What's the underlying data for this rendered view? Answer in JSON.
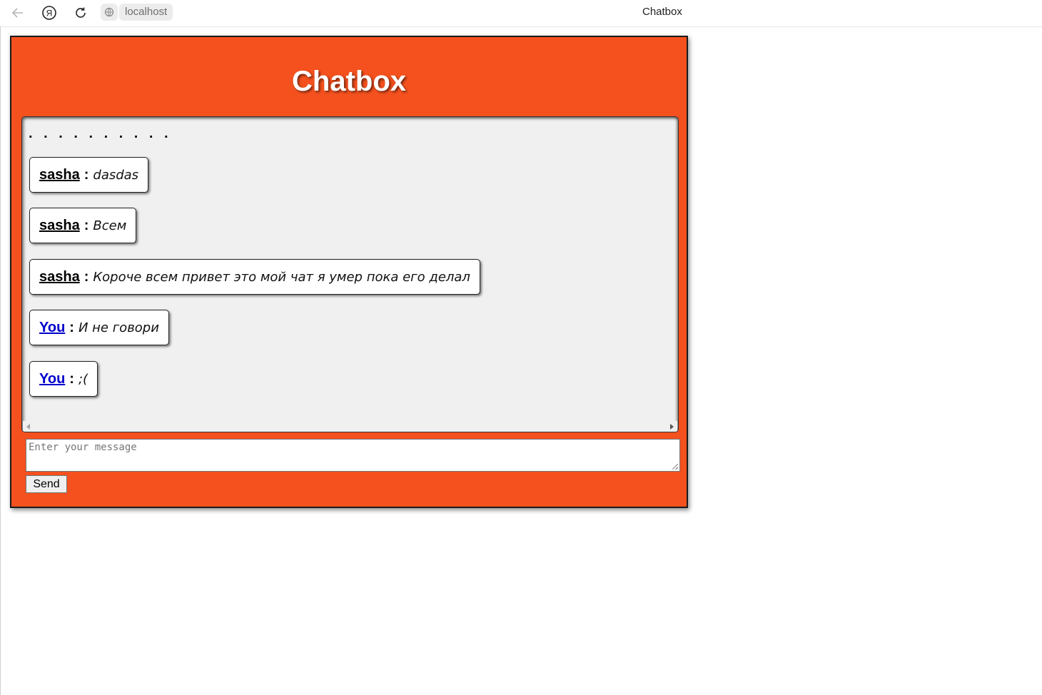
{
  "browser": {
    "url": "localhost",
    "tab_title": "Chatbox",
    "icons": [
      "back-arrow-icon",
      "yandex-icon",
      "reload-icon",
      "site-icon"
    ]
  },
  "chat": {
    "title": "Chatbox",
    "dots": ". . . . . . . . . .",
    "messages": [
      {
        "user": "sasha",
        "sep": ":",
        "text": "dasdas"
      },
      {
        "user": "sasha",
        "sep": ":",
        "text": "Всем"
      },
      {
        "user": "sasha",
        "sep": ":",
        "text": "Короче всем привет это мой чат я умер пока его делал"
      },
      {
        "user": "You",
        "sep": ":",
        "text": "И не говори"
      },
      {
        "user": "You",
        "sep": ":",
        "text": ";("
      }
    ],
    "input_placeholder": "Enter your message",
    "input_value": "",
    "send_label": "Send"
  },
  "colors": {
    "accent": "#f4511e",
    "own_user": "#0000cc",
    "other_user": "#000000"
  }
}
